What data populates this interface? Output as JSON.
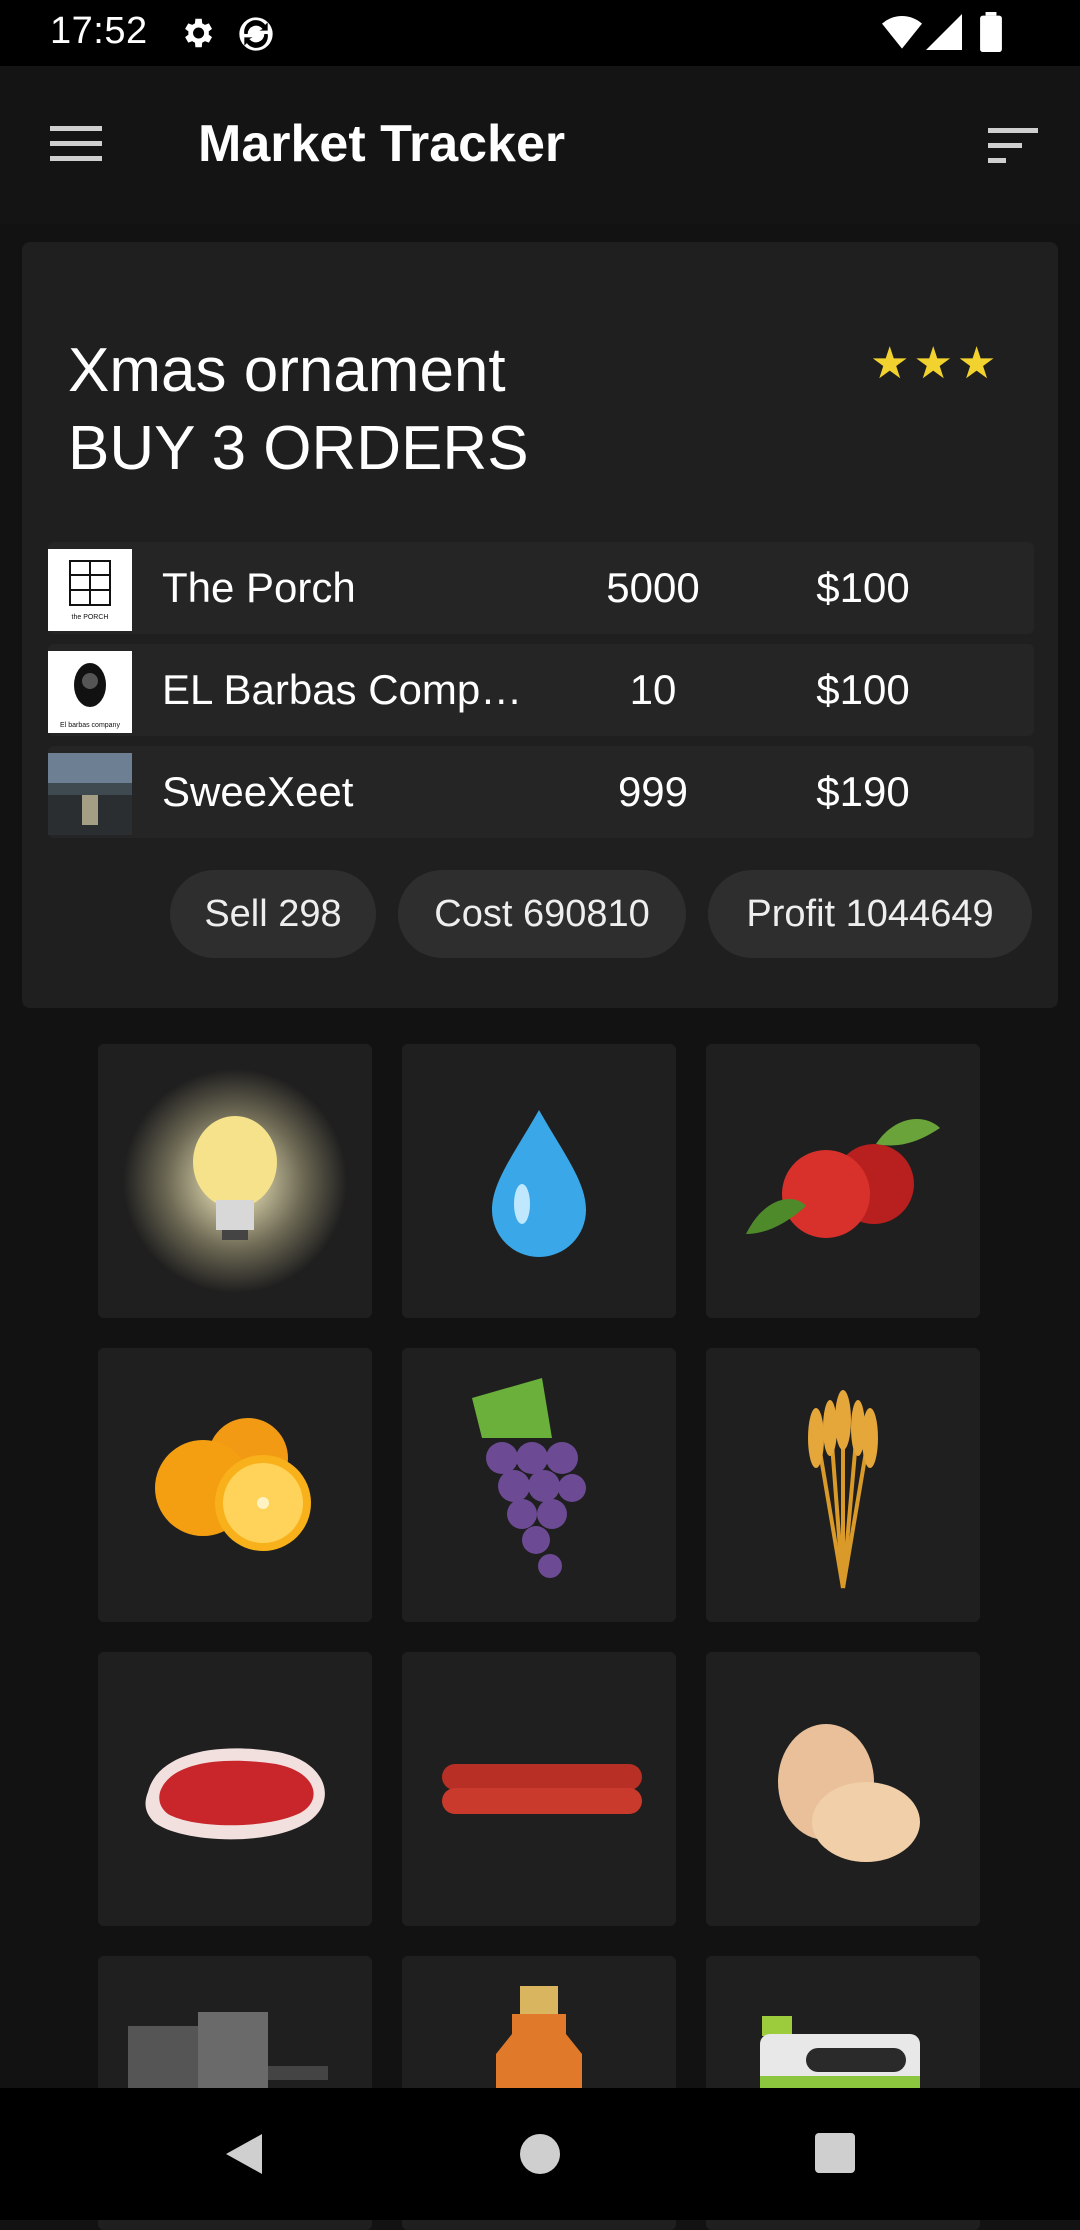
{
  "status_bar": {
    "time": "17:52",
    "icons": [
      "gear-icon",
      "sync-icon",
      "wifi-icon",
      "signal-icon",
      "battery-icon"
    ]
  },
  "app_bar": {
    "title": "Market Tracker",
    "menu_icon": "hamburger-menu-icon",
    "sort_icon": "sort-icon"
  },
  "order_card": {
    "title_line1": "Xmas ornament",
    "title_line2": "BUY 3 ORDERS",
    "rating_stars": 3,
    "stars_text": "★★★",
    "star_color": "#f2d22e",
    "orders": [
      {
        "name": "The Porch",
        "quantity": "5000",
        "price": "$100",
        "thumb_text": "the PORCH"
      },
      {
        "name": "EL Barbas Comp…",
        "quantity": "10",
        "price": "$100",
        "thumb_text": "El barbas company"
      },
      {
        "name": "SweeXeet",
        "quantity": "999",
        "price": "$190"
      }
    ],
    "chips": {
      "sell": "Sell 298",
      "cost": "Cost 690810",
      "profit": "Profit 1044649"
    }
  },
  "item_grid": {
    "items": [
      "lightbulb",
      "water-drop",
      "apple",
      "orange",
      "grapes",
      "wheat",
      "steak",
      "sausages",
      "eggs",
      "oil-barrels",
      "bottle",
      "jerrycan"
    ]
  },
  "nav_bar": {
    "buttons": [
      "back-button",
      "home-button",
      "recents-button"
    ]
  },
  "colors": {
    "background": "#121212",
    "card": "#1f1f1f",
    "chip": "#2e2e2e"
  }
}
